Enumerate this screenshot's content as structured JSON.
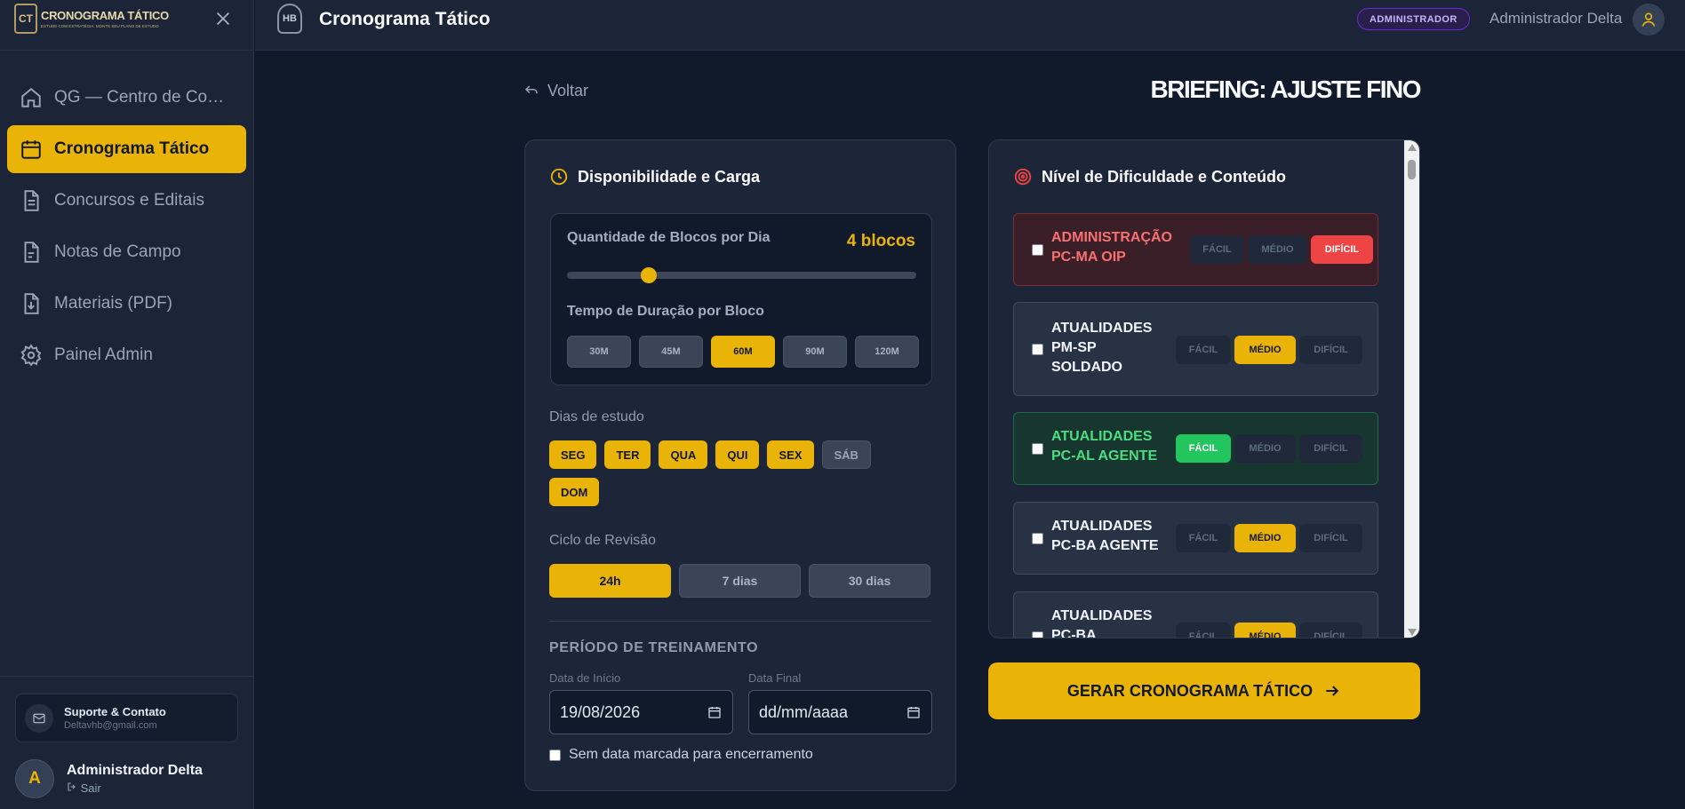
{
  "brand": {
    "title": "CRONOGRAMA TÁTICO",
    "tagline": "ESTUDE COM ESTRATÉGIA. MONTE SEU PLANO DE ESTUDO",
    "mark": "CT"
  },
  "sidebar": {
    "items": [
      {
        "label": "QG — Centro de Comando",
        "icon": "home-icon"
      },
      {
        "label": "Cronograma Tático",
        "icon": "calendar-icon",
        "active": true
      },
      {
        "label": "Concursos e Editais",
        "icon": "document-icon"
      },
      {
        "label": "Notas de Campo",
        "icon": "notes-icon"
      },
      {
        "label": "Materiais (PDF)",
        "icon": "download-file-icon"
      },
      {
        "label": "Painel Admin",
        "icon": "gear-icon"
      }
    ],
    "support": {
      "title": "Suporte & Contato",
      "email": "Deltavhb@gmail.com"
    },
    "user": {
      "initial": "A",
      "name": "Administrador Delta",
      "logout": "Sair"
    }
  },
  "topbar": {
    "logo": "HB",
    "title": "Cronograma Tático",
    "role": "ADMINISTRADOR",
    "user": "Administrador Delta"
  },
  "page": {
    "back": "Voltar",
    "title": "BRIEFING: AJUSTE FINO"
  },
  "availability": {
    "title": "Disponibilidade e Carga",
    "blocks_label": "Quantidade de Blocos por Dia",
    "blocks_value": "4 blocos",
    "blocks_fraction": 0.22,
    "duration_label": "Tempo de Duração por Bloco",
    "durations": [
      {
        "label": "30M"
      },
      {
        "label": "45M"
      },
      {
        "label": "60M",
        "on": true
      },
      {
        "label": "90M"
      },
      {
        "label": "120M"
      }
    ],
    "days_label": "Dias de estudo",
    "days": [
      {
        "label": "SEG",
        "on": true
      },
      {
        "label": "TER",
        "on": true
      },
      {
        "label": "QUA",
        "on": true
      },
      {
        "label": "QUI",
        "on": true
      },
      {
        "label": "SEX",
        "on": true
      },
      {
        "label": "SÁB",
        "on": false
      },
      {
        "label": "DOM",
        "on": true
      }
    ],
    "cycle_label": "Ciclo de Revisão",
    "cycles": [
      {
        "label": "24h",
        "on": true
      },
      {
        "label": "7 dias"
      },
      {
        "label": "30 dias"
      }
    ],
    "period_title": "PERÍODO DE TREINAMENTO",
    "start_label": "Data de Início",
    "start_value": "19/08/2026",
    "end_label": "Data Final",
    "end_placeholder": "dd/mm/aaaa",
    "no_end_label": "Sem data marcada para encerramento"
  },
  "difficulty": {
    "title": "Nível de Dificuldade e Conteúdo",
    "levels": [
      "FÁCIL",
      "MÉDIO",
      "DIFÍCIL"
    ],
    "subjects": [
      {
        "line1": "ADMINISTRAÇÃO",
        "line2": "PC-MA OIP",
        "selected": "DIFÍCIL"
      },
      {
        "line1": "ATUALIDADES",
        "line2": "PM-SP",
        "line3": "SOLDADO",
        "selected": "MÉDIO"
      },
      {
        "line1": "ATUALIDADES",
        "line2": "PC-AL AGENTE",
        "selected": "FÁCIL"
      },
      {
        "line1": "ATUALIDADES",
        "line2": "PC-BA AGENTE",
        "selected": "MÉDIO"
      },
      {
        "line1": "ATUALIDADES",
        "line2": "PC-BA",
        "selected": "MÉDIO"
      }
    ]
  },
  "generate_label": "GERAR CRONOGRAMA TÁTICO",
  "colors": {
    "accent": "#eab308",
    "bg": "#111a2b",
    "panel": "#1c2638",
    "hard": "#ef4444",
    "easy": "#22c55e",
    "admin": "#c4b5fd"
  }
}
